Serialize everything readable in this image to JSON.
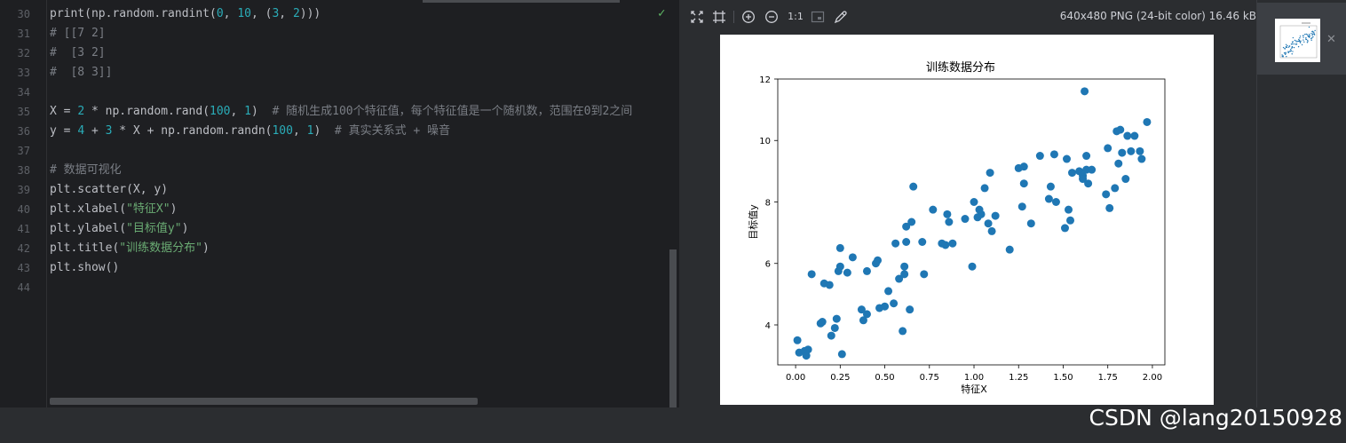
{
  "editor": {
    "line_numbers": [
      "30",
      "31",
      "32",
      "33",
      "34",
      "35",
      "36",
      "37",
      "38",
      "39",
      "40",
      "41",
      "42",
      "43",
      "44"
    ],
    "lines": [
      [
        {
          "t": "print(np.random.randint(",
          "c": "def"
        },
        {
          "t": "0",
          "c": "num"
        },
        {
          "t": ", ",
          "c": "def"
        },
        {
          "t": "10",
          "c": "num"
        },
        {
          "t": ", (",
          "c": "def"
        },
        {
          "t": "3",
          "c": "num"
        },
        {
          "t": ", ",
          "c": "def"
        },
        {
          "t": "2",
          "c": "num"
        },
        {
          "t": ")))",
          "c": "def"
        }
      ],
      [
        {
          "t": "# [[7 2]",
          "c": "com"
        }
      ],
      [
        {
          "t": "#  [3 2]",
          "c": "com"
        }
      ],
      [
        {
          "t": "#  [8 3]]",
          "c": "com"
        }
      ],
      [],
      [
        {
          "t": "X = ",
          "c": "def"
        },
        {
          "t": "2",
          "c": "num"
        },
        {
          "t": " * np.random.rand(",
          "c": "def"
        },
        {
          "t": "100",
          "c": "num"
        },
        {
          "t": ", ",
          "c": "def"
        },
        {
          "t": "1",
          "c": "num"
        },
        {
          "t": ")  ",
          "c": "def"
        },
        {
          "t": "# 随机生成100个特征值，每个特征值是一个随机数，范围在0到2之间",
          "c": "com"
        }
      ],
      [
        {
          "t": "y = ",
          "c": "def"
        },
        {
          "t": "4",
          "c": "num"
        },
        {
          "t": " + ",
          "c": "def"
        },
        {
          "t": "3",
          "c": "num"
        },
        {
          "t": " * X + np.random.randn(",
          "c": "def"
        },
        {
          "t": "100",
          "c": "num"
        },
        {
          "t": ", ",
          "c": "def"
        },
        {
          "t": "1",
          "c": "num"
        },
        {
          "t": ")  ",
          "c": "def"
        },
        {
          "t": "# 真实关系式 + 噪音",
          "c": "com"
        }
      ],
      [],
      [
        {
          "t": "# 数据可视化",
          "c": "com"
        }
      ],
      [
        {
          "t": "plt.scatter(X, y)",
          "c": "def"
        }
      ],
      [
        {
          "t": "plt.xlabel(",
          "c": "def"
        },
        {
          "t": "\"特征X\"",
          "c": "str"
        },
        {
          "t": ")",
          "c": "def"
        }
      ],
      [
        {
          "t": "plt.ylabel(",
          "c": "def"
        },
        {
          "t": "\"目标值y\"",
          "c": "str"
        },
        {
          "t": ")",
          "c": "def"
        }
      ],
      [
        {
          "t": "plt.title(",
          "c": "def"
        },
        {
          "t": "\"训练数据分布\"",
          "c": "str"
        },
        {
          "t": ")",
          "c": "def"
        }
      ],
      [
        {
          "t": "plt.show()",
          "c": "def"
        }
      ],
      []
    ]
  },
  "viewer": {
    "zoom_label": "1:1",
    "image_info": "640x480 PNG (24-bit color) 16.46 kB"
  },
  "watermark": "CSDN @lang20150928",
  "chart_data": {
    "type": "scatter",
    "title": "训练数据分布",
    "xlabel": "特征X",
    "ylabel": "目标值y",
    "xticks": [
      "0.00",
      "0.25",
      "0.50",
      "0.75",
      "1.00",
      "1.25",
      "1.50",
      "1.75",
      "2.00"
    ],
    "yticks": [
      "4",
      "6",
      "8",
      "10",
      "12"
    ],
    "xlim": [
      -0.1,
      2.07
    ],
    "ylim": [
      2.7,
      12.0
    ],
    "grid": false,
    "marker_color": "#1f77b4",
    "points": [
      [
        0.01,
        3.5
      ],
      [
        0.02,
        3.1
      ],
      [
        0.05,
        3.15
      ],
      [
        0.06,
        3.0
      ],
      [
        0.07,
        3.2
      ],
      [
        0.09,
        5.65
      ],
      [
        0.14,
        4.05
      ],
      [
        0.15,
        4.1
      ],
      [
        0.16,
        5.35
      ],
      [
        0.19,
        5.3
      ],
      [
        0.2,
        3.65
      ],
      [
        0.22,
        3.9
      ],
      [
        0.23,
        4.2
      ],
      [
        0.24,
        5.75
      ],
      [
        0.25,
        5.9
      ],
      [
        0.25,
        6.5
      ],
      [
        0.26,
        3.05
      ],
      [
        0.29,
        5.7
      ],
      [
        0.32,
        6.2
      ],
      [
        0.37,
        4.5
      ],
      [
        0.38,
        4.15
      ],
      [
        0.4,
        4.35
      ],
      [
        0.4,
        5.75
      ],
      [
        0.45,
        6.0
      ],
      [
        0.46,
        6.1
      ],
      [
        0.47,
        4.55
      ],
      [
        0.5,
        4.6
      ],
      [
        0.52,
        5.1
      ],
      [
        0.55,
        4.7
      ],
      [
        0.56,
        6.65
      ],
      [
        0.58,
        5.5
      ],
      [
        0.6,
        3.8
      ],
      [
        0.61,
        5.65
      ],
      [
        0.61,
        5.9
      ],
      [
        0.62,
        7.2
      ],
      [
        0.62,
        6.7
      ],
      [
        0.64,
        4.5
      ],
      [
        0.65,
        7.35
      ],
      [
        0.66,
        8.5
      ],
      [
        0.71,
        6.7
      ],
      [
        0.72,
        5.65
      ],
      [
        0.77,
        7.75
      ],
      [
        0.82,
        6.65
      ],
      [
        0.84,
        6.6
      ],
      [
        0.85,
        7.6
      ],
      [
        0.86,
        7.35
      ],
      [
        0.88,
        6.65
      ],
      [
        0.95,
        7.45
      ],
      [
        0.99,
        5.9
      ],
      [
        1.0,
        8.0
      ],
      [
        1.02,
        7.5
      ],
      [
        1.03,
        7.75
      ],
      [
        1.04,
        7.6
      ],
      [
        1.06,
        8.45
      ],
      [
        1.08,
        7.3
      ],
      [
        1.09,
        8.95
      ],
      [
        1.1,
        7.05
      ],
      [
        1.12,
        7.55
      ],
      [
        1.2,
        6.45
      ],
      [
        1.25,
        9.1
      ],
      [
        1.27,
        7.85
      ],
      [
        1.28,
        8.6
      ],
      [
        1.28,
        9.15
      ],
      [
        1.32,
        7.3
      ],
      [
        1.37,
        9.5
      ],
      [
        1.42,
        8.1
      ],
      [
        1.43,
        8.5
      ],
      [
        1.45,
        9.55
      ],
      [
        1.46,
        8.0
      ],
      [
        1.51,
        7.15
      ],
      [
        1.52,
        9.4
      ],
      [
        1.53,
        7.75
      ],
      [
        1.54,
        7.4
      ],
      [
        1.55,
        8.95
      ],
      [
        1.59,
        9.0
      ],
      [
        1.61,
        8.85
      ],
      [
        1.61,
        8.75
      ],
      [
        1.62,
        11.6
      ],
      [
        1.63,
        9.5
      ],
      [
        1.63,
        9.05
      ],
      [
        1.64,
        8.6
      ],
      [
        1.66,
        9.05
      ],
      [
        1.74,
        8.25
      ],
      [
        1.75,
        9.75
      ],
      [
        1.76,
        7.8
      ],
      [
        1.79,
        8.45
      ],
      [
        1.8,
        10.3
      ],
      [
        1.81,
        9.25
      ],
      [
        1.82,
        10.35
      ],
      [
        1.83,
        9.6
      ],
      [
        1.85,
        8.75
      ],
      [
        1.86,
        10.15
      ],
      [
        1.88,
        9.65
      ],
      [
        1.9,
        10.15
      ],
      [
        1.93,
        9.65
      ],
      [
        1.94,
        9.4
      ],
      [
        1.97,
        10.6
      ]
    ]
  }
}
